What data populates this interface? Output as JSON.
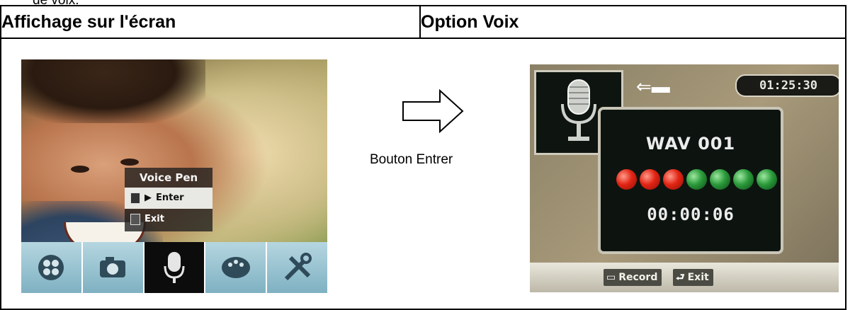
{
  "page_top_fragment": "de voix.",
  "table": {
    "col1_header": "Affichage sur l'écran",
    "col2_header": "Option Voix"
  },
  "left_screen": {
    "popup_title": "Voice Pen",
    "menu_items": [
      "Enter",
      "Exit"
    ],
    "selected_item": "Enter",
    "selection_marker": "▶",
    "mode_icons": [
      "movie-mode-icon",
      "camera-mode-icon",
      "microphone-mode-icon",
      "palette-icon",
      "tools-icon"
    ],
    "active_mode": "microphone-mode-icon"
  },
  "transition": {
    "arrow_icon": "right-arrow-outline-icon",
    "label": "Bouton Entrer"
  },
  "right_screen": {
    "time_remaining": "01:25:30",
    "file_name": "WAV 001",
    "level_leds": [
      "red",
      "red",
      "red",
      "green",
      "green",
      "green",
      "green"
    ],
    "elapsed_time": "00:00:06",
    "record_label": "Record",
    "exit_label": "Exit",
    "colors": {
      "led_red": "#e22414",
      "led_green": "#2a9a3a"
    }
  }
}
